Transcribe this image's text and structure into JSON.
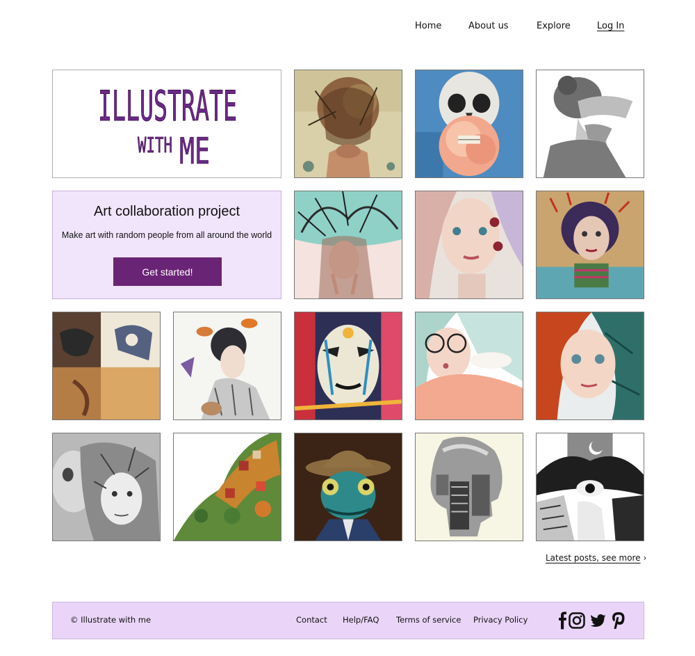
{
  "nav": {
    "home": "Home",
    "about": "About us",
    "explore": "Explore",
    "login": "Log In"
  },
  "logo": {
    "line1": "ILLUSTRATE",
    "line2a": "WITH",
    "line2b": "ME",
    "color": "#6b2a86"
  },
  "cta": {
    "title": "Art collaboration project",
    "subtitle": "Make art with random people from all around the world",
    "button": "Get started!",
    "button_color": "#6a2476",
    "background": "#f1e5fb"
  },
  "gallery": {
    "tiles": [
      {
        "name": "collage-face-artwork"
      },
      {
        "name": "skull-rose-artwork"
      },
      {
        "name": "pencil-girl-artwork"
      },
      {
        "name": "tree-hair-girl-artwork"
      },
      {
        "name": "floral-face-girl-artwork"
      },
      {
        "name": "retro-woman-artwork"
      },
      {
        "name": "patchwork-faces-artwork"
      },
      {
        "name": "woman-birds-artwork"
      },
      {
        "name": "colorful-mask-artwork"
      },
      {
        "name": "glasses-girl-artwork"
      },
      {
        "name": "redhead-girl-artwork"
      },
      {
        "name": "skull-woman-artwork"
      },
      {
        "name": "village-hill-artwork"
      },
      {
        "name": "chameleon-hat-artwork"
      },
      {
        "name": "city-silhouette-artwork"
      },
      {
        "name": "moon-embrace-artwork"
      }
    ]
  },
  "see_more": "Latest posts, see more",
  "footer": {
    "copyright": "© Illustrate with me",
    "links": {
      "contact": "Contact",
      "help": "Help/FAQ",
      "terms": "Terms of service",
      "privacy": "Privacy Policy"
    },
    "social": [
      "facebook-icon",
      "instagram-icon",
      "twitter-icon",
      "pinterest-icon"
    ],
    "background": "#ead5f8"
  }
}
